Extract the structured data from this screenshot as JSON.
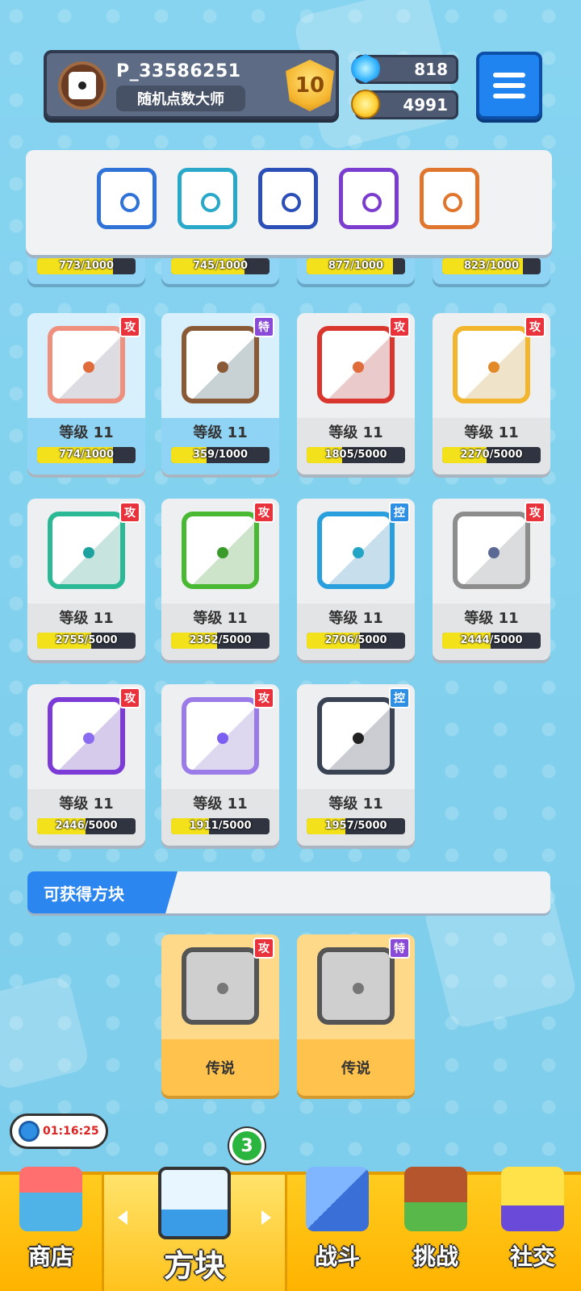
{
  "profile": {
    "player_id": "P_33586251",
    "title": "随机点数大师",
    "rank": "10"
  },
  "currency": {
    "gems": "818",
    "coins": "4991"
  },
  "deck": [
    {
      "name": "ice-dice",
      "color": "#2f73d9"
    },
    {
      "name": "wind-dice",
      "color": "#2aa8c9"
    },
    {
      "name": "moon-dice",
      "color": "#2b4fb7"
    },
    {
      "name": "arcane-dice",
      "color": "#7a3dd0"
    },
    {
      "name": "elemental-dice",
      "color": "#e0762e"
    }
  ],
  "partial_row": [
    "773/1000",
    "745/1000",
    "877/1000",
    "823/1000"
  ],
  "cards": [
    {
      "tag": "攻",
      "type": "atk",
      "level": "等级 11",
      "progress": "774/1000",
      "fill": 0.774,
      "color": "#ef8f7d",
      "pip": "#e06b3b",
      "blue": true
    },
    {
      "tag": "特",
      "type": "spc",
      "level": "等级 11",
      "progress": "359/1000",
      "fill": 0.359,
      "color": "#8a5a36",
      "pip": "#8a5a36",
      "blue": true
    },
    {
      "tag": "攻",
      "type": "atk",
      "level": "等级 11",
      "progress": "1805/5000",
      "fill": 0.361,
      "color": "#d9362d",
      "pip": "#e06b3b",
      "blue": false
    },
    {
      "tag": "攻",
      "type": "atk",
      "level": "等级 11",
      "progress": "2270/5000",
      "fill": 0.454,
      "color": "#f2b52b",
      "pip": "#e28a2a",
      "blue": false
    },
    {
      "tag": "攻",
      "type": "atk",
      "level": "等级 11",
      "progress": "2755/5000",
      "fill": 0.551,
      "color": "#2bb895",
      "pip": "#1ea2a0",
      "blue": false
    },
    {
      "tag": "攻",
      "type": "atk",
      "level": "等级 11",
      "progress": "2352/5000",
      "fill": 0.47,
      "color": "#49b934",
      "pip": "#3a9a2a",
      "blue": false
    },
    {
      "tag": "控",
      "type": "ctl",
      "level": "等级 11",
      "progress": "2706/5000",
      "fill": 0.541,
      "color": "#2a9fde",
      "pip": "#25a5c5",
      "blue": false
    },
    {
      "tag": "攻",
      "type": "atk",
      "level": "等级 11",
      "progress": "2444/5000",
      "fill": 0.489,
      "color": "#8d8d8d",
      "pip": "#5a6a95",
      "blue": false
    },
    {
      "tag": "攻",
      "type": "atk",
      "level": "等级 11",
      "progress": "2446/5000",
      "fill": 0.489,
      "color": "#7c3ad6",
      "pip": "#8a6cf0",
      "blue": false
    },
    {
      "tag": "攻",
      "type": "atk",
      "level": "等级 11",
      "progress": "1911/5000",
      "fill": 0.382,
      "color": "#9b7be8",
      "pip": "#7c5ef0",
      "blue": false
    },
    {
      "tag": "控",
      "type": "ctl",
      "level": "等级 11",
      "progress": "1957/5000",
      "fill": 0.391,
      "color": "#3a4353",
      "pip": "#222",
      "blue": false
    }
  ],
  "obtainable": {
    "title": "可获得方块",
    "items": [
      {
        "tag": "攻",
        "type": "atk",
        "label": "传说"
      },
      {
        "tag": "特",
        "type": "spc",
        "label": "传说"
      }
    ]
  },
  "timer": "01:16:25",
  "nav": {
    "badge": "3",
    "items": [
      {
        "label": "商店",
        "icon": "shop-icon"
      },
      {
        "label": "方块",
        "icon": "dice-box-icon"
      },
      {
        "label": "战斗",
        "icon": "battle-icon"
      },
      {
        "label": "挑战",
        "icon": "challenge-icon"
      },
      {
        "label": "社交",
        "icon": "social-icon"
      }
    ]
  }
}
